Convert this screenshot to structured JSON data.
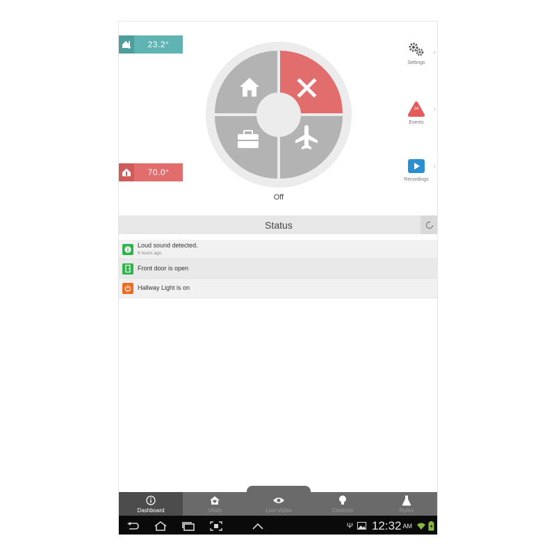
{
  "temps": {
    "indoor": "23.2°",
    "setpoint": "70.0°"
  },
  "mode": {
    "current": "Off",
    "options": [
      "home",
      "off",
      "work",
      "away"
    ]
  },
  "side_nav": [
    {
      "label": "Settings",
      "icon": "gears-icon"
    },
    {
      "label": "Events",
      "icon": "alert-triangle-icon",
      "count": "34"
    },
    {
      "label": "Recordings",
      "icon": "play-icon"
    }
  ],
  "status": {
    "title": "Status",
    "items": [
      {
        "text": "Loud sound detected.",
        "sub": "6 hours ago",
        "icon": "info-icon",
        "color": "#2fb34a"
      },
      {
        "text": "Front door is open",
        "sub": "",
        "icon": "door-icon",
        "color": "#2fb34a"
      },
      {
        "text": "Hallway Light is on",
        "sub": "",
        "icon": "power-icon",
        "color": "#ef6b1f"
      }
    ]
  },
  "tabs": [
    {
      "label": "Dashboard",
      "active": true
    },
    {
      "label": "Vitals",
      "active": false
    },
    {
      "label": "Live Video",
      "active": false
    },
    {
      "label": "Controls",
      "active": false
    },
    {
      "label": "Rules",
      "active": false
    }
  ],
  "system": {
    "time": "12:32",
    "ampm": "AM"
  },
  "colors": {
    "teal": "#5fb3b3",
    "red": "#e26d6d",
    "dial_gray": "#b3b3b3",
    "events_red": "#e75a5a",
    "recordings_blue": "#2a8fd0"
  }
}
